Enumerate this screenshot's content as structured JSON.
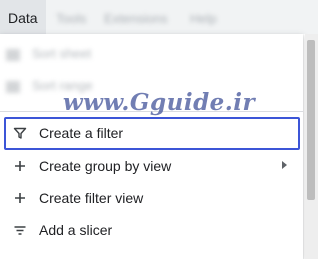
{
  "menubar": {
    "active_menu": "Data",
    "blurred_menus": [
      "Tools",
      "Extensions",
      "Help"
    ]
  },
  "dropdown": {
    "blurred_items": [
      "Sort sheet",
      "Sort range"
    ],
    "items": [
      {
        "label": "Create a filter",
        "icon": "filter-icon",
        "has_submenu": false,
        "highlighted": true
      },
      {
        "label": "Create group by view",
        "icon": "plus-icon",
        "has_submenu": true,
        "highlighted": false
      },
      {
        "label": "Create filter view",
        "icon": "plus-icon",
        "has_submenu": false,
        "highlighted": false
      },
      {
        "label": "Add a slicer",
        "icon": "slicer-icon",
        "has_submenu": false,
        "highlighted": false
      }
    ]
  },
  "watermark": "www.Gguide.ir",
  "colors": {
    "highlight_border": "#3c55d7",
    "menubar_bg": "#f1f3f4",
    "text": "#202124",
    "icon": "#5f6368"
  }
}
